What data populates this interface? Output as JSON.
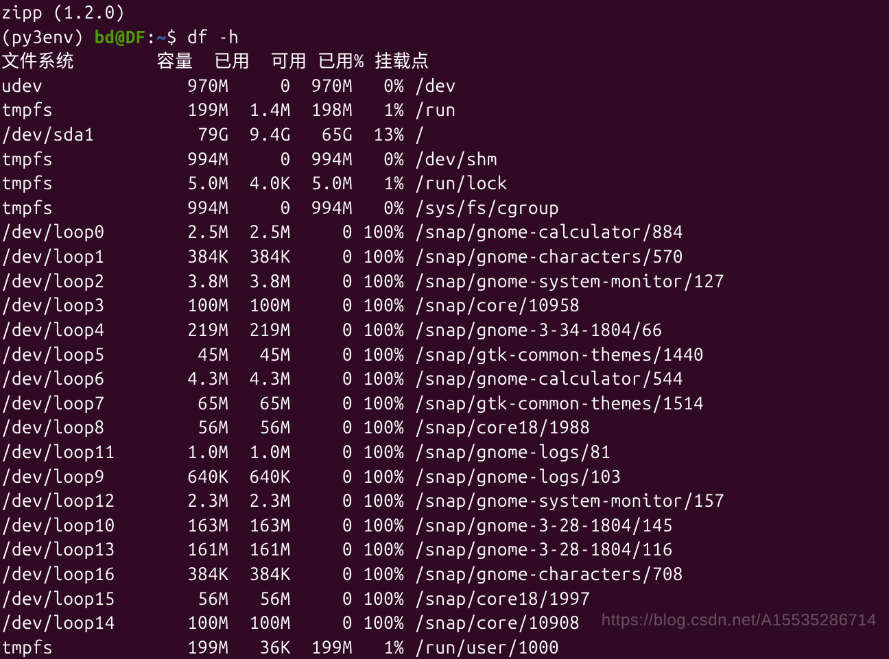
{
  "top_line": "zipp (1.2.0)",
  "prompt": {
    "env": "(py3env) ",
    "user_host": "bd@DF",
    "colon": ":",
    "path": "~",
    "dollar": "$ "
  },
  "command": "df -h",
  "headers": {
    "filesystem": "文件系统",
    "size": "容量",
    "used": "已用",
    "avail": "可用",
    "usepct": "已用%",
    "mount": "挂载点"
  },
  "rows": [
    {
      "fs": "udev",
      "size": "970M",
      "used": "0",
      "avail": "970M",
      "pct": "0%",
      "mount": "/dev"
    },
    {
      "fs": "tmpfs",
      "size": "199M",
      "used": "1.4M",
      "avail": "198M",
      "pct": "1%",
      "mount": "/run"
    },
    {
      "fs": "/dev/sda1",
      "size": "79G",
      "used": "9.4G",
      "avail": "65G",
      "pct": "13%",
      "mount": "/"
    },
    {
      "fs": "tmpfs",
      "size": "994M",
      "used": "0",
      "avail": "994M",
      "pct": "0%",
      "mount": "/dev/shm"
    },
    {
      "fs": "tmpfs",
      "size": "5.0M",
      "used": "4.0K",
      "avail": "5.0M",
      "pct": "1%",
      "mount": "/run/lock"
    },
    {
      "fs": "tmpfs",
      "size": "994M",
      "used": "0",
      "avail": "994M",
      "pct": "0%",
      "mount": "/sys/fs/cgroup"
    },
    {
      "fs": "/dev/loop0",
      "size": "2.5M",
      "used": "2.5M",
      "avail": "0",
      "pct": "100%",
      "mount": "/snap/gnome-calculator/884"
    },
    {
      "fs": "/dev/loop1",
      "size": "384K",
      "used": "384K",
      "avail": "0",
      "pct": "100%",
      "mount": "/snap/gnome-characters/570"
    },
    {
      "fs": "/dev/loop2",
      "size": "3.8M",
      "used": "3.8M",
      "avail": "0",
      "pct": "100%",
      "mount": "/snap/gnome-system-monitor/127"
    },
    {
      "fs": "/dev/loop3",
      "size": "100M",
      "used": "100M",
      "avail": "0",
      "pct": "100%",
      "mount": "/snap/core/10958"
    },
    {
      "fs": "/dev/loop4",
      "size": "219M",
      "used": "219M",
      "avail": "0",
      "pct": "100%",
      "mount": "/snap/gnome-3-34-1804/66"
    },
    {
      "fs": "/dev/loop5",
      "size": "45M",
      "used": "45M",
      "avail": "0",
      "pct": "100%",
      "mount": "/snap/gtk-common-themes/1440"
    },
    {
      "fs": "/dev/loop6",
      "size": "4.3M",
      "used": "4.3M",
      "avail": "0",
      "pct": "100%",
      "mount": "/snap/gnome-calculator/544"
    },
    {
      "fs": "/dev/loop7",
      "size": "65M",
      "used": "65M",
      "avail": "0",
      "pct": "100%",
      "mount": "/snap/gtk-common-themes/1514"
    },
    {
      "fs": "/dev/loop8",
      "size": "56M",
      "used": "56M",
      "avail": "0",
      "pct": "100%",
      "mount": "/snap/core18/1988"
    },
    {
      "fs": "/dev/loop11",
      "size": "1.0M",
      "used": "1.0M",
      "avail": "0",
      "pct": "100%",
      "mount": "/snap/gnome-logs/81"
    },
    {
      "fs": "/dev/loop9",
      "size": "640K",
      "used": "640K",
      "avail": "0",
      "pct": "100%",
      "mount": "/snap/gnome-logs/103"
    },
    {
      "fs": "/dev/loop12",
      "size": "2.3M",
      "used": "2.3M",
      "avail": "0",
      "pct": "100%",
      "mount": "/snap/gnome-system-monitor/157"
    },
    {
      "fs": "/dev/loop10",
      "size": "163M",
      "used": "163M",
      "avail": "0",
      "pct": "100%",
      "mount": "/snap/gnome-3-28-1804/145"
    },
    {
      "fs": "/dev/loop13",
      "size": "161M",
      "used": "161M",
      "avail": "0",
      "pct": "100%",
      "mount": "/snap/gnome-3-28-1804/116"
    },
    {
      "fs": "/dev/loop16",
      "size": "384K",
      "used": "384K",
      "avail": "0",
      "pct": "100%",
      "mount": "/snap/gnome-characters/708"
    },
    {
      "fs": "/dev/loop15",
      "size": "56M",
      "used": "56M",
      "avail": "0",
      "pct": "100%",
      "mount": "/snap/core18/1997"
    },
    {
      "fs": "/dev/loop14",
      "size": "100M",
      "used": "100M",
      "avail": "0",
      "pct": "100%",
      "mount": "/snap/core/10908"
    },
    {
      "fs": "tmpfs",
      "size": "199M",
      "used": "36K",
      "avail": "199M",
      "pct": "1%",
      "mount": "/run/user/1000"
    }
  ],
  "watermark": "https://blog.csdn.net/A15535286714"
}
